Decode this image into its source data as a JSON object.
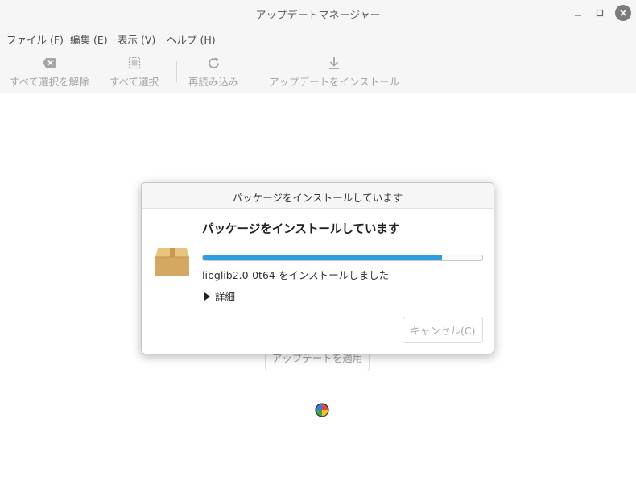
{
  "window": {
    "title": "アップデートマネージャー"
  },
  "menu": [
    {
      "label": "ファイル (F)"
    },
    {
      "label": "編集 (E)"
    },
    {
      "label": "表示 (V)"
    },
    {
      "label": "ヘルプ (H)"
    }
  ],
  "toolbar": {
    "clear_label": "すべて選択を解除",
    "select_all_label": "すべて選択",
    "refresh_label": "再読み込み",
    "install_label": "アップデートをインストール"
  },
  "main": {
    "apply_label": "アップデートを適用"
  },
  "dialog": {
    "title": "パッケージをインストールしています",
    "heading": "パッケージをインストールしています",
    "progress": 0.857,
    "status": "libglib2.0-0t64 をインストールしました",
    "details_label": "詳細",
    "cancel_label": "キャンセル(C)"
  },
  "colors": {
    "accent": "#2d9fe0"
  }
}
